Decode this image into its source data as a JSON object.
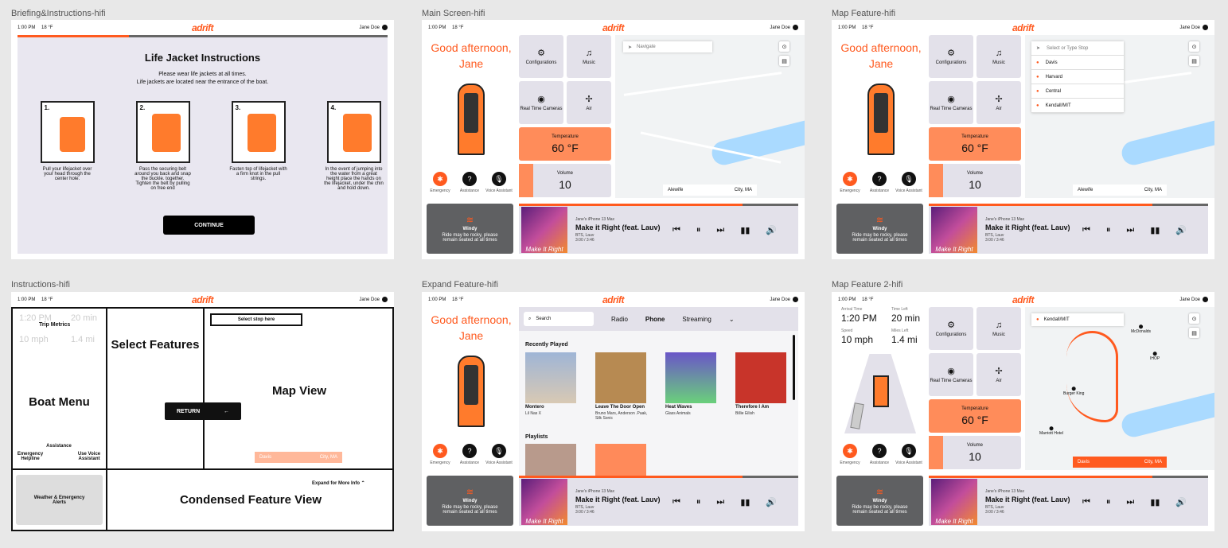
{
  "frames": {
    "briefing": "Briefing&Instructions-hifi",
    "main": "Main Screen-hifi",
    "map": "Map Feature-hifi",
    "instructions": "Instructions-hifi",
    "expand": "Expand Feature-hifi",
    "map2": "Map Feature 2-hifi"
  },
  "status": {
    "time": "1:00 PM",
    "temp": "18 °F",
    "user": "Jane Doe",
    "logo": "adrift"
  },
  "briefing": {
    "title": "Life Jacket Instructions",
    "line1": "Please wear life jackets at all times.",
    "line2": "Life jackets are located near the entrance of the boat.",
    "steps": [
      {
        "n": "1.",
        "text": "Pull your lifejacket over your head through the center hole."
      },
      {
        "n": "2.",
        "text": "Pass the securing belt around you back and snap the buckle. together. Tighten the belt by pulling on free end"
      },
      {
        "n": "3.",
        "text": "Fasten top of lifejacket with a firm knot in the pull strings."
      },
      {
        "n": "4.",
        "text": "In the event of jumping into the water from a great height place the hands on the lifejacket, under the chin and hold down."
      }
    ],
    "continue": "CONTINUE"
  },
  "main": {
    "greeting1": "Good afternoon,",
    "greeting2": "Jane",
    "configurations": "Configurations",
    "music": "Music",
    "cameras": "Real Time Cameras",
    "air": "Air",
    "temp_label": "Temperature",
    "temp_value": "60 °F",
    "volume_label": "Volume",
    "volume_value": "10",
    "emergency": "Emergency",
    "assistance": "Assistance",
    "voice": "Voice Assistant",
    "navigate": "Navigate",
    "loc_from": "Alewife",
    "loc_to": "City, MA",
    "weather_title": "Windy",
    "weather_text": "Ride may be rocky, please remain seated at all times",
    "device": "Jane's iPhone 13 Max",
    "song": "Make it Right (feat. Lauv)",
    "artist": "BTS, Lauv",
    "time": "3:00 / 3:46",
    "art_text": "Make It Right"
  },
  "map": {
    "search": "Select or Type Stop",
    "stops": [
      "Davis",
      "Harvard",
      "Central",
      "Kendall/MIT"
    ]
  },
  "instr": {
    "trip_metrics": "Trip Metrics",
    "select_stop": "Select stop here",
    "select_features": "Select Features",
    "map_view": "Map View",
    "boat_menu": "Boat Menu",
    "return": "RETURN",
    "assistance": "Assistance",
    "emergency_helpline": "Emergency Helpline",
    "use_voice": "Use Voice Assistant",
    "weather_alerts": "Weather & Emergency Alerts",
    "condensed": "Condensed Feature View",
    "expand_more": "Expand for More Info",
    "arrival": "1:20 PM",
    "left": "20 min",
    "speed": "10 mph",
    "miles": "1.4 mi",
    "davis": "Davis"
  },
  "expand": {
    "search": "Search",
    "tabs": [
      "Radio",
      "Phone",
      "Streaming"
    ],
    "recent": "Recently Played",
    "playlists": "Playlists",
    "albums": [
      {
        "title": "Montero",
        "artist": "Lil Nas X"
      },
      {
        "title": "Leave The Door Open",
        "artist": "Bruno Mars, Anderson .Paak, Silk Sonic"
      },
      {
        "title": "Heat Waves",
        "artist": "Glass Animals"
      },
      {
        "title": "Therefore I Am",
        "artist": "Billie Eilish"
      }
    ]
  },
  "map2": {
    "arrival_label": "Arrival Time",
    "arrival": "1:20 PM",
    "left_label": "Time Left",
    "left": "20 min",
    "speed_label": "Speed",
    "speed": "10 mph",
    "miles_label": "Miles Left",
    "miles": "1.4 mi",
    "dest": "Kendall/MIT",
    "loc_from": "Davis",
    "loc_to": "City, MA",
    "pins": [
      "McDonalds",
      "IHOP",
      "Burger King",
      "Marriott Hotel"
    ]
  },
  "colors": {
    "accent": "#ff5a1f",
    "panel": "#e3e1ea",
    "dark": "#5f6062"
  },
  "icons": [
    "gear-icon",
    "music-icon",
    "camera-icon",
    "fan-icon",
    "emergency-icon",
    "help-icon",
    "mic-icon",
    "volume-icon",
    "play-pause-icon",
    "location-icon"
  ]
}
